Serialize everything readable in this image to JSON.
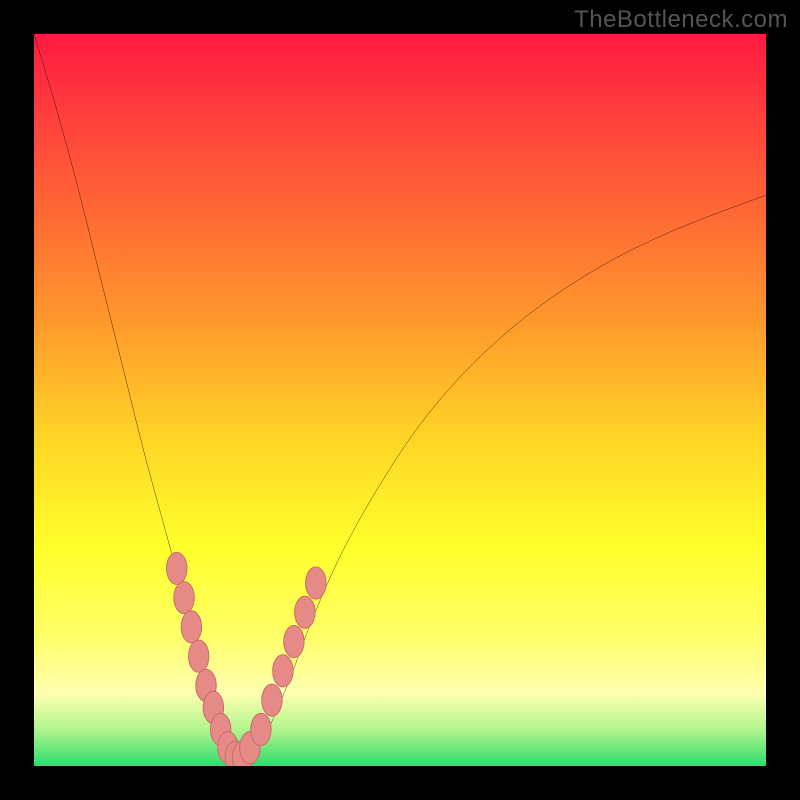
{
  "watermark": "TheBottleneck.com",
  "colors": {
    "frame": "#000000",
    "curve": "#000000",
    "marker_fill": "#e58a86",
    "marker_stroke": "#c96763",
    "gradient_top": "#ff1a41",
    "gradient_bottom": "#2fdc6d"
  },
  "chart_data": {
    "type": "line",
    "title": "",
    "xlabel": "",
    "ylabel": "",
    "xlim": [
      0,
      100
    ],
    "ylim": [
      0,
      100
    ],
    "grid": false,
    "legend": false,
    "note": "Bottleneck-percentage style V-curve; y=0 (green) is optimal, y=100 (red) is worst. Axis values estimated from plot extent.",
    "series": [
      {
        "name": "bottleneck-curve",
        "x": [
          0,
          3,
          6,
          9,
          12,
          15,
          18,
          21,
          24,
          26,
          27,
          28,
          29,
          30,
          32,
          35,
          38,
          42,
          47,
          53,
          60,
          68,
          77,
          87,
          100
        ],
        "y": [
          100,
          90,
          79,
          67,
          55,
          43,
          32,
          21,
          11,
          5,
          2,
          1,
          1,
          2,
          5,
          12,
          20,
          29,
          38,
          47,
          55,
          62,
          68,
          73,
          78
        ]
      }
    ],
    "markers": {
      "name": "highlighted-points",
      "note": "Pink lozenge markers clustered near the curve minimum on both branches",
      "points": [
        {
          "x": 19.5,
          "y": 27
        },
        {
          "x": 20.5,
          "y": 23
        },
        {
          "x": 21.5,
          "y": 19
        },
        {
          "x": 22.5,
          "y": 15
        },
        {
          "x": 23.5,
          "y": 11
        },
        {
          "x": 24.5,
          "y": 8
        },
        {
          "x": 25.5,
          "y": 5
        },
        {
          "x": 26.5,
          "y": 2.5
        },
        {
          "x": 27.5,
          "y": 1.2
        },
        {
          "x": 28.5,
          "y": 1.2
        },
        {
          "x": 29.5,
          "y": 2.5
        },
        {
          "x": 31,
          "y": 5
        },
        {
          "x": 32.5,
          "y": 9
        },
        {
          "x": 34,
          "y": 13
        },
        {
          "x": 35.5,
          "y": 17
        },
        {
          "x": 37,
          "y": 21
        },
        {
          "x": 38.5,
          "y": 25
        }
      ]
    }
  }
}
